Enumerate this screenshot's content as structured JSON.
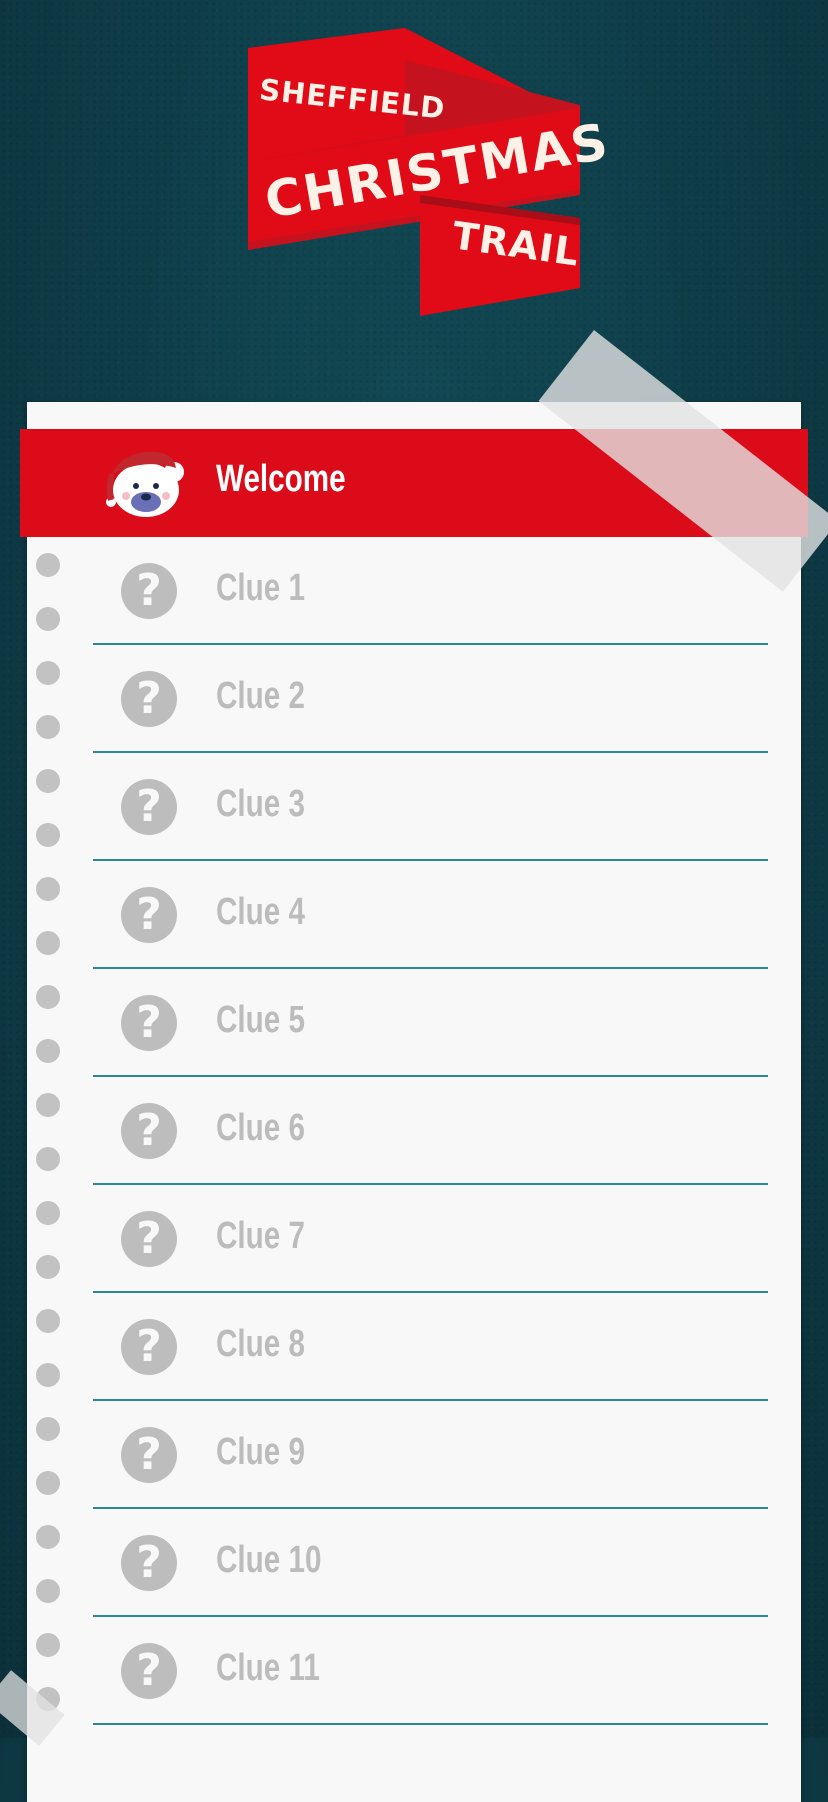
{
  "logo": {
    "line1": "SHEFFIELD",
    "line2": "CHRISTMAS",
    "line3": "TRAIL"
  },
  "colors": {
    "background": "#0f3f4a",
    "accent_red": "#dc0b19",
    "rule_teal": "#2a8a8f",
    "inactive_grey": "#bdbdbd"
  },
  "welcome": {
    "label": "Welcome",
    "icon": "santa-bear-icon"
  },
  "clues": [
    {
      "label": "Clue 1",
      "icon": "question-mark-icon"
    },
    {
      "label": "Clue 2",
      "icon": "question-mark-icon"
    },
    {
      "label": "Clue 3",
      "icon": "question-mark-icon"
    },
    {
      "label": "Clue 4",
      "icon": "question-mark-icon"
    },
    {
      "label": "Clue 5",
      "icon": "question-mark-icon"
    },
    {
      "label": "Clue 6",
      "icon": "question-mark-icon"
    },
    {
      "label": "Clue 7",
      "icon": "question-mark-icon"
    },
    {
      "label": "Clue 8",
      "icon": "question-mark-icon"
    },
    {
      "label": "Clue 9",
      "icon": "question-mark-icon"
    },
    {
      "label": "Clue 10",
      "icon": "question-mark-icon"
    },
    {
      "label": "Clue 11",
      "icon": "question-mark-icon"
    }
  ]
}
